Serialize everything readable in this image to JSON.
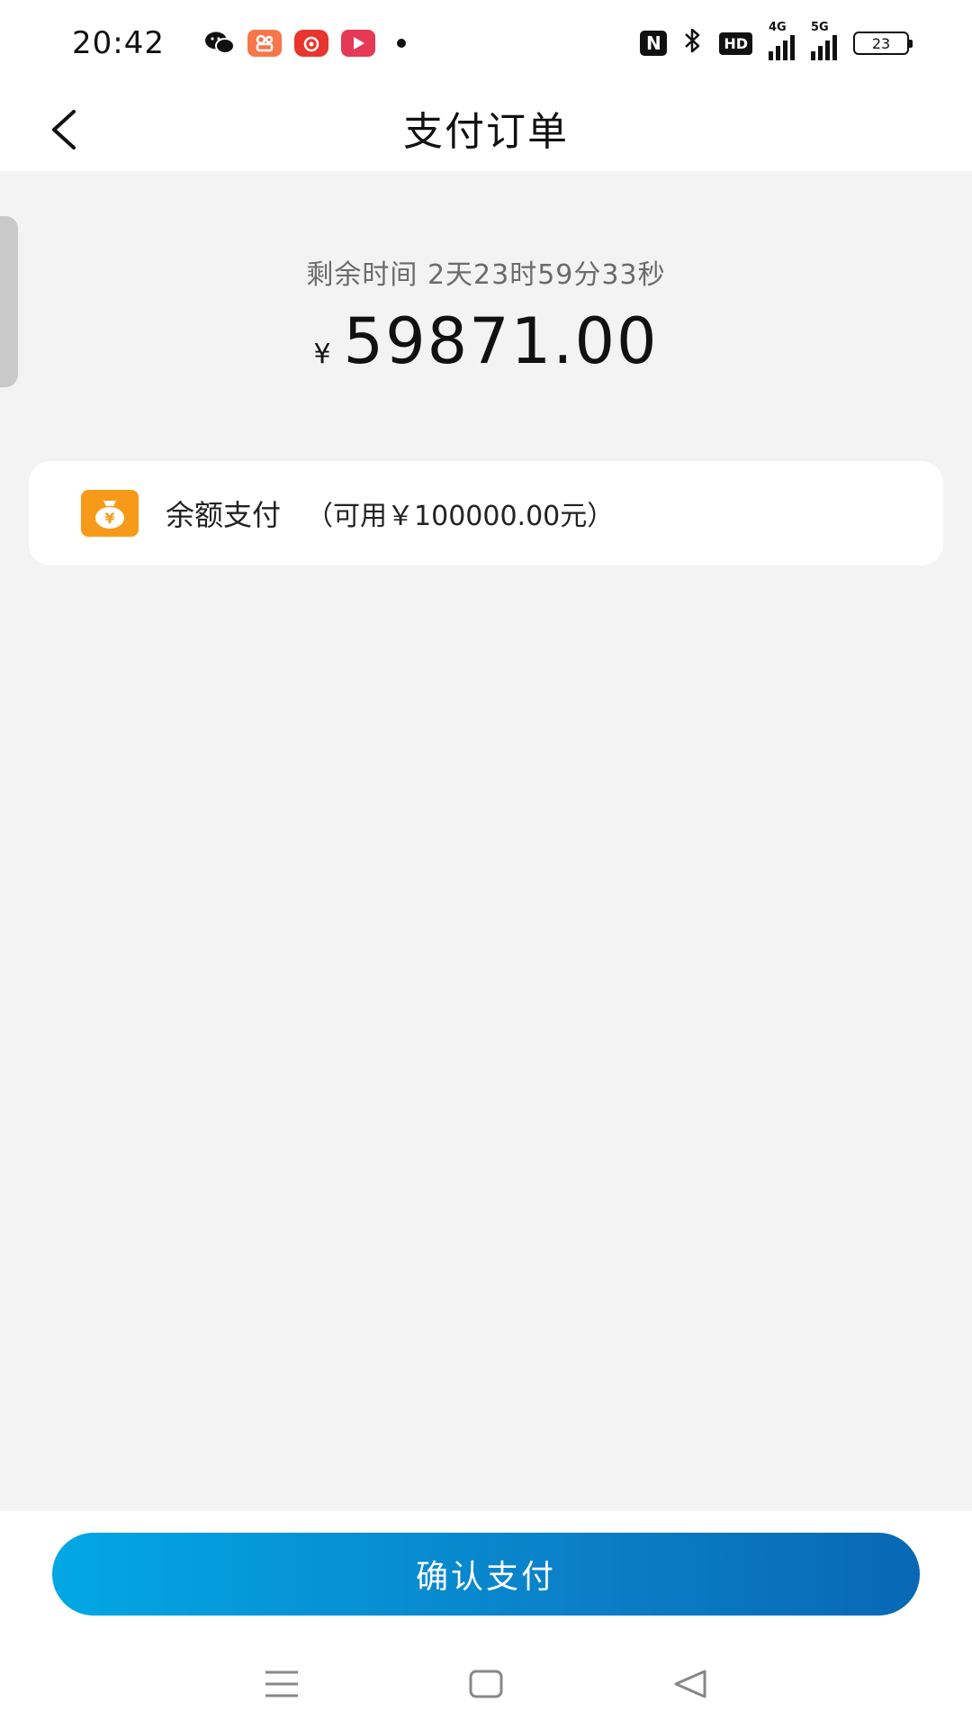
{
  "status_bar": {
    "time": "20:42",
    "notification_icons": [
      "wechat-icon",
      "kuaishou-icon",
      "netease-music-icon",
      "video-icon"
    ],
    "system_icons": [
      "nfc-icon",
      "bluetooth-icon",
      "hd-icon",
      "signal-4g-icon",
      "signal-5g-icon",
      "battery-icon"
    ],
    "nfc_text": "N",
    "hd_text": "HD",
    "signal_4g": "4G",
    "signal_5g": "5G",
    "battery_level": "23"
  },
  "header": {
    "title": "支付订单"
  },
  "order": {
    "countdown": "剩余时间 2天23时59分33秒",
    "currency_symbol": "¥",
    "amount": "59871.00"
  },
  "payment_method": {
    "label": "余额支付",
    "available": "（可用￥100000.00元）"
  },
  "actions": {
    "confirm_label": "确认支付"
  },
  "colors": {
    "accent_start": "#02a7e4",
    "accent_end": "#0868b5",
    "wallet_icon": "#f79a1a",
    "background": "#f3f3f3"
  }
}
